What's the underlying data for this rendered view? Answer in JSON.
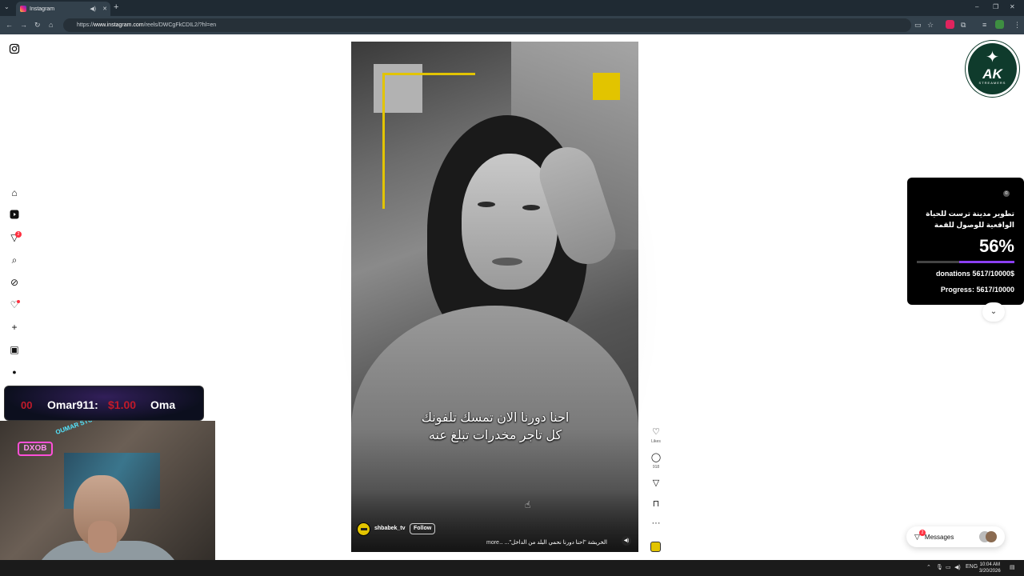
{
  "browser": {
    "tab_title": "Instagram",
    "url_prefix": "https://",
    "url_host": "www.instagram.com",
    "url_path": "/reels/DWCgFkCDIL2/?hl=en",
    "new_tab_symbol": "+",
    "close_symbol": "✕",
    "minimize_symbol": "–",
    "restore_symbol": "❐",
    "window_close_symbol": "✕"
  },
  "sidebar": {
    "notifications_badge": "2",
    "items": [
      "home",
      "reels",
      "messages",
      "search",
      "explore",
      "notifications",
      "create",
      "dashboard",
      "profile"
    ]
  },
  "reel": {
    "subtitle_line1": "احنا دورنا الان تمسك تلفونك",
    "subtitle_line2": "كل تاجر مخدرات تبلغ عنه",
    "username": "shbabek_tv",
    "follow_label": "Follow",
    "caption": "الخريشة \"احنا دورنا نحمي البلد من الداخل\"... ...",
    "more_label": "more",
    "likes_label": "Likes",
    "comments_count": "918"
  },
  "overlay": {
    "logo_text": "AK",
    "logo_subtext": "STREAMERS",
    "donation_title": "تطوير مدينة ترست للحياة الواقعية للوصول للقمة",
    "donation_percent": "56%",
    "donation_progress": 0.5617,
    "donations_line": "donations 5617/10000$",
    "progress_line": "Progress: 5617/10000",
    "accent_color": "#8b3ff2"
  },
  "messages": {
    "label": "Messages",
    "badge": "2"
  },
  "ticker": {
    "count": "00",
    "name": "Omar911:",
    "amount": "$1.00",
    "name_repeat": "Oma"
  },
  "webcam": {
    "neon_sign": "DXOB",
    "neon_script": "OUMAR STORE"
  },
  "taskbar": {
    "language": "ENG",
    "time": "10:04 AM",
    "date": "3/20/2026"
  }
}
